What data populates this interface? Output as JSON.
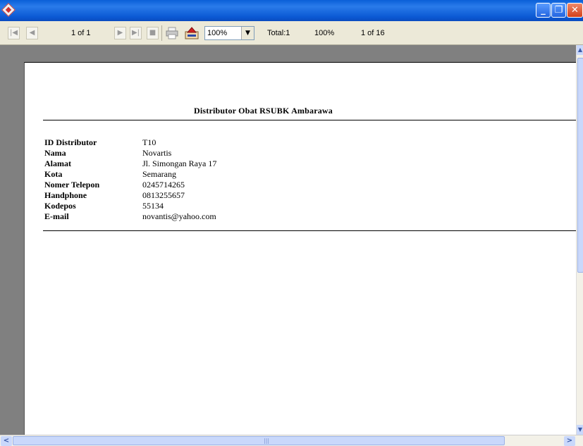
{
  "window": {
    "minimize_glyph": "_",
    "restore_glyph": "❐",
    "close_glyph": "✕"
  },
  "toolbar": {
    "first_glyph": "|◀",
    "prev_glyph": "◀",
    "page_label": "1 of 1",
    "next_glyph": "▶",
    "last_glyph": "▶|",
    "stop_glyph": "■",
    "zoom_value": "100%",
    "dropdown_glyph": "▼",
    "total_label": "Total:1",
    "percent_label": "100%",
    "records_label": "1 of 16",
    "icons": [
      "print-icon",
      "export-icon"
    ]
  },
  "report": {
    "title": "Distributor Obat RSUBK Ambarawa",
    "fields": [
      {
        "label": "ID Distributor",
        "value": "T10"
      },
      {
        "label": "Nama",
        "value": "Novartis"
      },
      {
        "label": "Alamat",
        "value": "Jl. Simongan Raya 17"
      },
      {
        "label": "Kota",
        "value": "Semarang"
      },
      {
        "label": "Nomer Telepon",
        "value": "0245714265"
      },
      {
        "label": "Handphone",
        "value": "0813255657"
      },
      {
        "label": "Kodepos",
        "value": "55134"
      },
      {
        "label": "E-mail",
        "value": "novantis@yahoo.com"
      }
    ]
  },
  "scrollbars": {
    "up_glyph": "▲",
    "down_glyph": "▼",
    "left_glyph": "<",
    "right_glyph": ">",
    "grip": "|||"
  },
  "colors": {
    "titlebar": "#0a5fd8",
    "workspace": "#808080",
    "toolbar": "#ece9d8",
    "close_button": "#d4401a"
  }
}
